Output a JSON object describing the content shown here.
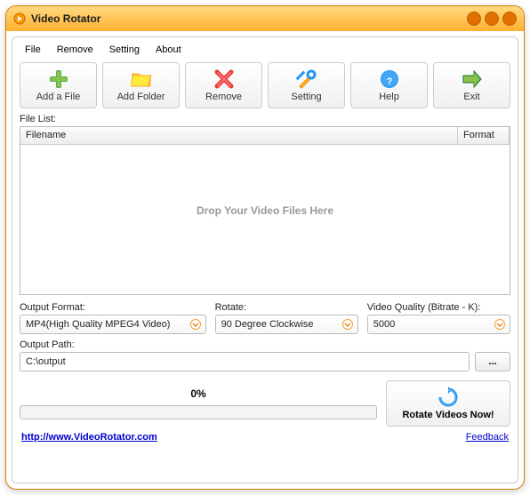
{
  "app": {
    "title": "Video Rotator"
  },
  "menu": {
    "file": "File",
    "remove": "Remove",
    "setting": "Setting",
    "about": "About"
  },
  "toolbar": {
    "add_file": "Add a File",
    "add_folder": "Add Folder",
    "remove": "Remove",
    "setting": "Setting",
    "help": "Help",
    "exit": "Exit"
  },
  "filelist": {
    "label": "File List:",
    "col_filename": "Filename",
    "col_format": "Format",
    "drop_hint": "Drop Your Video Files Here"
  },
  "settings": {
    "output_format_label": "Output Format:",
    "output_format_value": "MP4(High Quality MPEG4 Video)",
    "rotate_label": "Rotate:",
    "rotate_value": "90 Degree Clockwise",
    "quality_label": "Video Quality (Bitrate - K):",
    "quality_value": "5000"
  },
  "output_path": {
    "label": "Output Path:",
    "value": "C:\\output",
    "browse": "..."
  },
  "progress": {
    "label": "0%"
  },
  "action": {
    "rotate_now": "Rotate Videos Now!"
  },
  "footer": {
    "url": "http://www.VideoRotator.com",
    "feedback": "Feedback"
  }
}
